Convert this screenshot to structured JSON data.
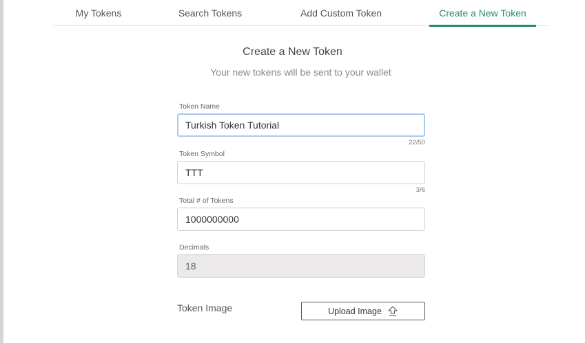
{
  "tabs": [
    {
      "label": "My Tokens",
      "active": false
    },
    {
      "label": "Search Tokens",
      "active": false
    },
    {
      "label": "Add Custom Token",
      "active": false
    },
    {
      "label": "Create a New Token",
      "active": true
    }
  ],
  "colors": {
    "accent": "#2a8c63",
    "focus_border": "#a6cbf1",
    "disabled_bg": "#ebe9e9"
  },
  "form": {
    "title": "Create a New Token",
    "subtitle": "Your new tokens will be sent to your wallet",
    "token_name": {
      "label": "Token Name",
      "value": "Turkish Token Tutorial",
      "counter": "22/50"
    },
    "token_symbol": {
      "label": "Token Symbol",
      "value": "TTT",
      "counter": "3/6"
    },
    "total_tokens": {
      "label": "Total # of Tokens",
      "value": "1000000000"
    },
    "decimals": {
      "label": "Decimals",
      "value": "18"
    },
    "token_image": {
      "label": "Token Image",
      "button_label": "Upload Image",
      "icon": "upload-icon"
    }
  }
}
